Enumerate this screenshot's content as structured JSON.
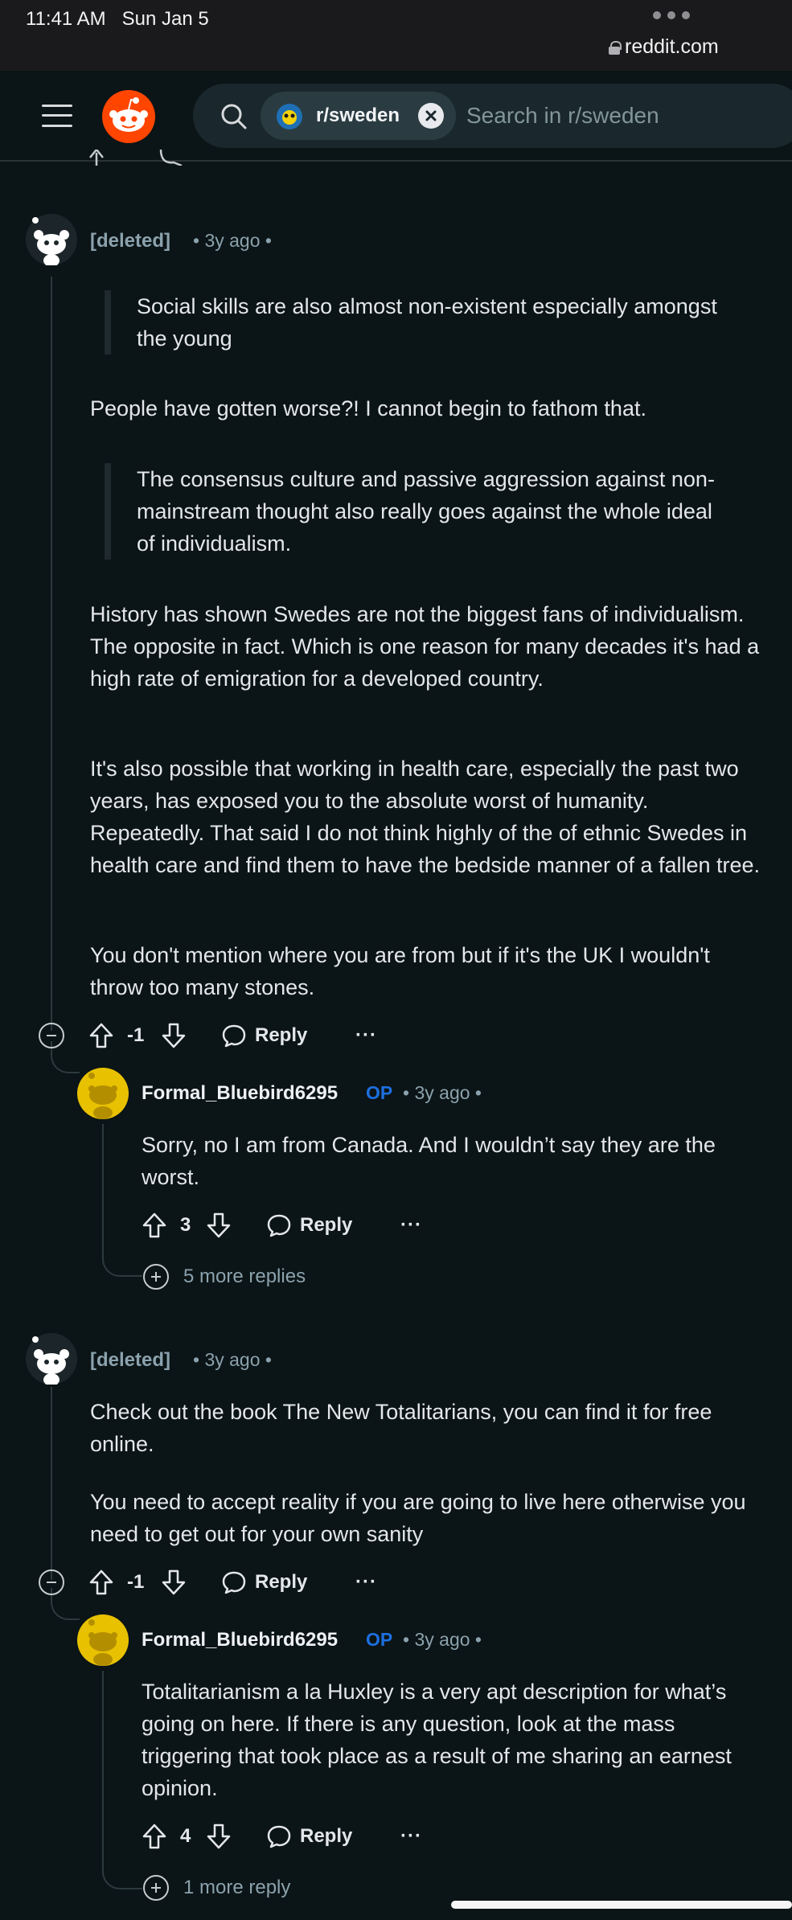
{
  "status_bar": {
    "time": "11:41 AM",
    "date": "Sun Jan 5",
    "url": "reddit.com"
  },
  "header": {
    "subreddit_chip": "r/sweden",
    "search_placeholder": "Search in r/sweden"
  },
  "colors": {
    "background": "#0b1416",
    "op_badge": "#1d6fe0",
    "reddit_orange": "#ff4500",
    "snoo_yellow": "#e8c100"
  },
  "comments": [
    {
      "author": "[deleted]",
      "age": "3y ago",
      "quote1": "Social skills are also almost non-existent especially amongst the young",
      "para1": "People have gotten worse?! I cannot begin to fathom that.",
      "quote2": "The consensus culture and passive aggression against non-mainstream thought also really goes against the whole ideal of individualism.",
      "para2": "History has shown Swedes are not the biggest fans of individualism. The opposite in fact. Which is one reason for many decades it's had a high rate of emigration for a developed country.",
      "para3": "It's also possible that working in health care, especially the past two years, has exposed you to the absolute worst of humanity. Repeatedly. That said I do not think highly of the of ethnic Swedes in health care and find them to have the bedside manner of a fallen tree.",
      "para4": "You don't mention where you are from but if it's the UK I wouldn't throw too many stones.",
      "votes": "-1",
      "reply_label": "Reply",
      "more_label": "···",
      "reply": {
        "author": "Formal_Bluebird6295",
        "op_badge": "OP",
        "age": "3y ago",
        "text": "Sorry, no I am from Canada. And I wouldn’t say they are the worst.",
        "votes": "3",
        "reply_label": "Reply",
        "more_label": "···",
        "more_replies": "5 more replies"
      }
    },
    {
      "author": "[deleted]",
      "age": "3y ago",
      "para1": "Check out the book The New Totalitarians, you can find it for free online.",
      "para2": "You need to accept reality if you are going to live here otherwise you need to get out for your own sanity",
      "votes": "-1",
      "reply_label": "Reply",
      "more_label": "···",
      "reply": {
        "author": "Formal_Bluebird6295",
        "op_badge": "OP",
        "age": "3y ago",
        "text": "Totalitarianism a la Huxley is a very apt description for what’s going on here. If there is any question, look at the mass triggering that took place as a result of me sharing an earnest opinion.",
        "votes": "4",
        "reply_label": "Reply",
        "more_label": "···",
        "more_replies": "1 more reply"
      }
    }
  ]
}
